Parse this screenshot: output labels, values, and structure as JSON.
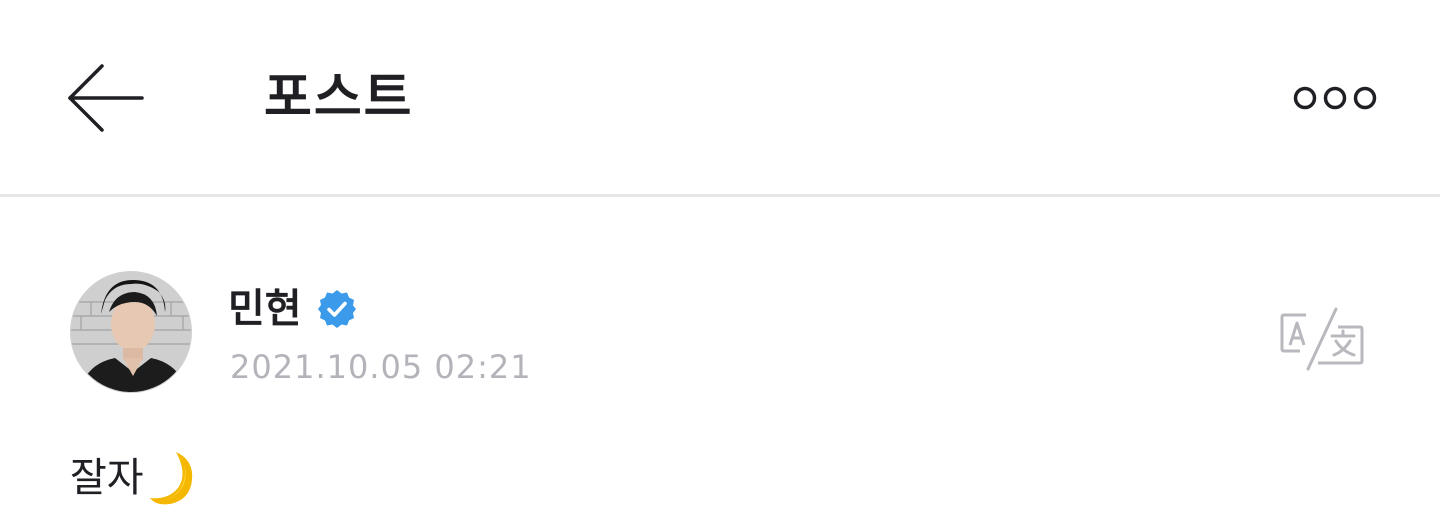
{
  "header": {
    "title": "포스트",
    "back_icon": "arrow-left-icon",
    "more_icon": "more-dots-icon"
  },
  "post": {
    "author": {
      "name": "민현",
      "verified": true,
      "verified_icon": "verified-badge-icon",
      "verified_color": "#3b9bea"
    },
    "timestamp": "2021.10.05 02:21",
    "translate_icon": "translate-icon",
    "body": {
      "text": "잘자",
      "emoji": "crescent-moon-icon"
    }
  },
  "colors": {
    "text_primary": "#1f1f24",
    "text_secondary": "#b3b3ba",
    "icon_muted": "#b8b8be",
    "divider": "#e6e6e9",
    "moon": "#f5b800"
  }
}
